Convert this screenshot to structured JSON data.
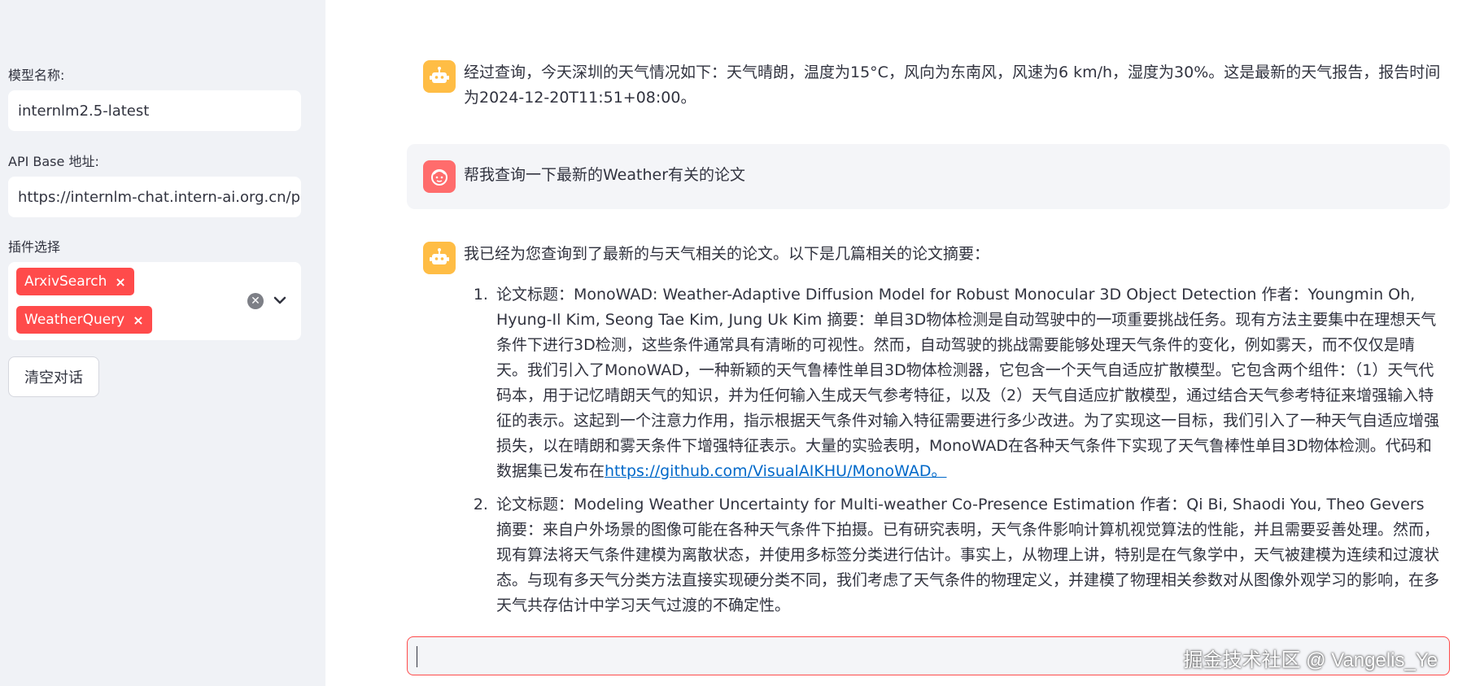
{
  "sidebar": {
    "model_label": "模型名称:",
    "model_value": "internlm2.5-latest",
    "api_label": "API Base 地址:",
    "api_value": "https://internlm-chat.intern-ai.org.cn/pu",
    "plugin_label": "插件选择",
    "plugins": [
      "ArxivSearch",
      "WeatherQuery"
    ],
    "clear_button": "清空对话"
  },
  "chat": {
    "messages": [
      {
        "role": "assistant",
        "text": "经过查询，今天深圳的天气情况如下：天气晴朗，温度为15°C，风向为东南风，风速为6 km/h，湿度为30%。这是最新的天气报告，报告时间为2024-12-20T11:51+08:00。"
      },
      {
        "role": "user",
        "text": "帮我查询一下最新的Weather有关的论文"
      },
      {
        "role": "assistant",
        "intro": "我已经为您查询到了最新的与天气相关的论文。以下是几篇相关的论文摘要：",
        "papers": [
          {
            "text": "论文标题：MonoWAD: Weather-Adaptive Diffusion Model for Robust Monocular 3D Object Detection 作者：Youngmin Oh, Hyung-Il Kim, Seong Tae Kim, Jung Uk Kim 摘要：单目3D物体检测是自动驾驶中的一项重要挑战任务。现有方法主要集中在理想天气条件下进行3D检测，这些条件通常具有清晰的可视性。然而，自动驾驶的挑战需要能够处理天气条件的变化，例如雾天，而不仅仅是晴天。我们引入了MonoWAD，一种新颖的天气鲁棒性单目3D物体检测器，它包含一个天气自适应扩散模型。它包含两个组件：（1）天气代码本，用于记忆晴朗天气的知识，并为任何输入生成天气参考特征，以及（2）天气自适应扩散模型，通过结合天气参考特征来增强输入特征的表示。这起到一个注意力作用，指示根据天气条件对输入特征需要进行多少改进。为了实现这一目标，我们引入了一种天气自适应增强损失，以在晴朗和雾天条件下增强特征表示。大量的实验表明，MonoWAD在各种天气条件下实现了天气鲁棒性单目3D物体检测。代码和数据集已发布在",
            "link": "https://github.com/VisualAIKHU/MonoWAD。"
          },
          {
            "text": "论文标题：Modeling Weather Uncertainty for Multi-weather Co-Presence Estimation 作者：Qi Bi, Shaodi You, Theo Gevers 摘要：来自户外场景的图像可能在各种天气条件下拍摄。已有研究表明，天气条件影响计算机视觉算法的性能，并且需要妥善处理。然而，现有算法将天气条件建模为离散状态，并使用多标签分类进行估计。事实上，从物理上讲，特别是在气象学中，天气被建模为连续和过渡状态。与现有多天气分类方法直接实现硬分类不同，我们考虑了天气条件的物理定义，并建模了物理相关参数对从图像外观学习的影响，在多天气共存估计中学习天气过渡的不确定性。",
            "link": ""
          }
        ]
      }
    ],
    "input_placeholder": "",
    "watermark": "掘金技术社区 @ Vangelis_Ye"
  },
  "colors": {
    "accent": "#ff4b4b",
    "bot_avatar": "#ffbd45",
    "user_avatar": "#ff6c6c",
    "sidebar_bg": "#f0f2f6"
  }
}
